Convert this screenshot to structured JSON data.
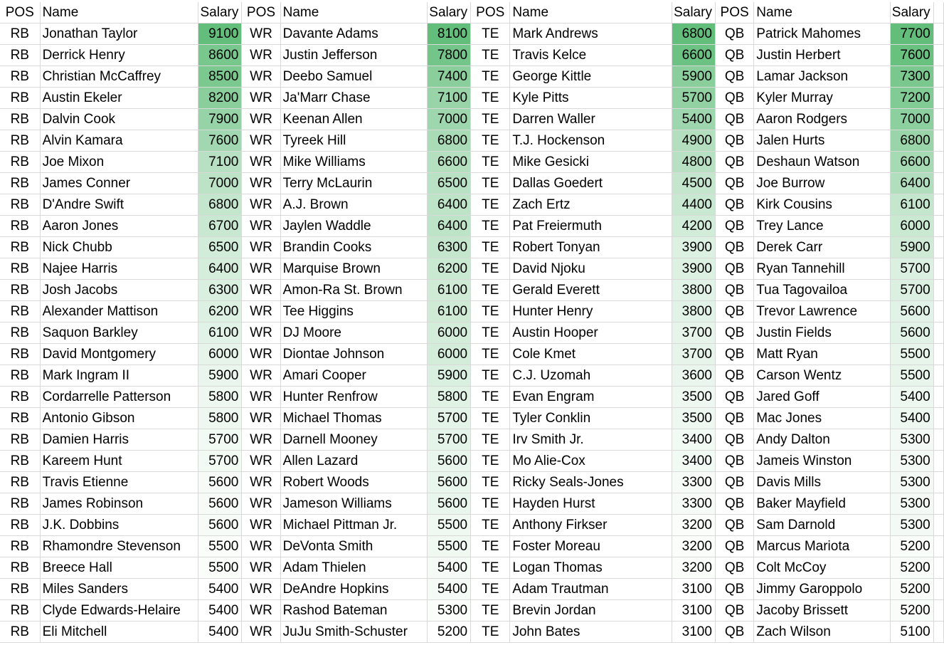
{
  "headers": [
    "POS",
    "Name",
    "Salary"
  ],
  "scale_colors": {
    "min": "#ffffff",
    "max": "#63be7b"
  },
  "groups": [
    {
      "pos": "RB",
      "players": [
        [
          "Jonathan Taylor",
          9100
        ],
        [
          "Derrick Henry",
          8600
        ],
        [
          "Christian McCaffrey",
          8500
        ],
        [
          "Austin Ekeler",
          8200
        ],
        [
          "Dalvin Cook",
          7900
        ],
        [
          "Alvin Kamara",
          7600
        ],
        [
          "Joe Mixon",
          7100
        ],
        [
          "James Conner",
          7000
        ],
        [
          "D'Andre Swift",
          6800
        ],
        [
          "Aaron Jones",
          6700
        ],
        [
          "Nick Chubb",
          6500
        ],
        [
          "Najee Harris",
          6400
        ],
        [
          "Josh Jacobs",
          6300
        ],
        [
          "Alexander Mattison",
          6200
        ],
        [
          "Saquon Barkley",
          6100
        ],
        [
          "David Montgomery",
          6000
        ],
        [
          "Mark Ingram II",
          5900
        ],
        [
          "Cordarrelle Patterson",
          5800
        ],
        [
          "Antonio Gibson",
          5800
        ],
        [
          "Damien Harris",
          5700
        ],
        [
          "Kareem Hunt",
          5700
        ],
        [
          "Travis Etienne",
          5600
        ],
        [
          "James Robinson",
          5600
        ],
        [
          "J.K. Dobbins",
          5600
        ],
        [
          "Rhamondre Stevenson",
          5500
        ],
        [
          "Breece Hall",
          5500
        ],
        [
          "Miles Sanders",
          5400
        ],
        [
          "Clyde Edwards-Helaire",
          5400
        ],
        [
          "Eli Mitchell",
          5400
        ]
      ]
    },
    {
      "pos": "WR",
      "players": [
        [
          "Davante Adams",
          8100
        ],
        [
          "Justin Jefferson",
          7800
        ],
        [
          "Deebo Samuel",
          7400
        ],
        [
          "Ja'Marr Chase",
          7100
        ],
        [
          "Keenan Allen",
          7000
        ],
        [
          "Tyreek Hill",
          6800
        ],
        [
          "Mike Williams",
          6600
        ],
        [
          "Terry McLaurin",
          6500
        ],
        [
          "A.J. Brown",
          6400
        ],
        [
          "Jaylen Waddle",
          6400
        ],
        [
          "Brandin Cooks",
          6300
        ],
        [
          "Marquise Brown",
          6200
        ],
        [
          "Amon-Ra St. Brown",
          6100
        ],
        [
          "Tee Higgins",
          6100
        ],
        [
          "DJ Moore",
          6000
        ],
        [
          "Diontae Johnson",
          6000
        ],
        [
          "Amari Cooper",
          5900
        ],
        [
          "Hunter Renfrow",
          5800
        ],
        [
          "Michael Thomas",
          5700
        ],
        [
          "Darnell Mooney",
          5700
        ],
        [
          "Allen Lazard",
          5600
        ],
        [
          "Robert Woods",
          5600
        ],
        [
          "Jameson Williams",
          5600
        ],
        [
          "Michael Pittman Jr.",
          5500
        ],
        [
          "DeVonta Smith",
          5500
        ],
        [
          "Adam Thielen",
          5400
        ],
        [
          "DeAndre Hopkins",
          5400
        ],
        [
          "Rashod Bateman",
          5300
        ],
        [
          "JuJu Smith-Schuster",
          5200
        ]
      ]
    },
    {
      "pos": "TE",
      "players": [
        [
          "Mark Andrews",
          6800
        ],
        [
          "Travis Kelce",
          6600
        ],
        [
          "George Kittle",
          5900
        ],
        [
          "Kyle Pitts",
          5700
        ],
        [
          "Darren Waller",
          5400
        ],
        [
          "T.J. Hockenson",
          4900
        ],
        [
          "Mike Gesicki",
          4800
        ],
        [
          "Dallas Goedert",
          4500
        ],
        [
          "Zach Ertz",
          4400
        ],
        [
          "Pat Freiermuth",
          4200
        ],
        [
          "Robert Tonyan",
          3900
        ],
        [
          "David Njoku",
          3900
        ],
        [
          "Gerald Everett",
          3800
        ],
        [
          "Hunter Henry",
          3800
        ],
        [
          "Austin Hooper",
          3700
        ],
        [
          "Cole Kmet",
          3700
        ],
        [
          "C.J. Uzomah",
          3600
        ],
        [
          "Evan Engram",
          3500
        ],
        [
          "Tyler Conklin",
          3500
        ],
        [
          "Irv Smith Jr.",
          3400
        ],
        [
          "Mo Alie-Cox",
          3400
        ],
        [
          "Ricky Seals-Jones",
          3300
        ],
        [
          "Hayden Hurst",
          3300
        ],
        [
          "Anthony Firkser",
          3200
        ],
        [
          "Foster Moreau",
          3200
        ],
        [
          "Logan Thomas",
          3200
        ],
        [
          "Adam Trautman",
          3100
        ],
        [
          "Brevin Jordan",
          3100
        ],
        [
          "John Bates",
          3100
        ]
      ]
    },
    {
      "pos": "QB",
      "players": [
        [
          "Patrick Mahomes",
          7700
        ],
        [
          "Justin Herbert",
          7600
        ],
        [
          "Lamar Jackson",
          7300
        ],
        [
          "Kyler Murray",
          7200
        ],
        [
          "Aaron Rodgers",
          7000
        ],
        [
          "Jalen Hurts",
          6800
        ],
        [
          "Deshaun Watson",
          6600
        ],
        [
          "Joe Burrow",
          6400
        ],
        [
          "Kirk Cousins",
          6100
        ],
        [
          "Trey Lance",
          6000
        ],
        [
          "Derek Carr",
          5900
        ],
        [
          "Ryan Tannehill",
          5700
        ],
        [
          "Tua Tagovailoa",
          5700
        ],
        [
          "Trevor Lawrence",
          5600
        ],
        [
          "Justin Fields",
          5600
        ],
        [
          "Matt Ryan",
          5500
        ],
        [
          "Carson Wentz",
          5500
        ],
        [
          "Jared Goff",
          5400
        ],
        [
          "Mac Jones",
          5400
        ],
        [
          "Andy Dalton",
          5300
        ],
        [
          "Jameis Winston",
          5300
        ],
        [
          "Davis Mills",
          5300
        ],
        [
          "Baker Mayfield",
          5300
        ],
        [
          "Sam Darnold",
          5300
        ],
        [
          "Marcus Mariota",
          5200
        ],
        [
          "Colt McCoy",
          5200
        ],
        [
          "Jimmy Garoppolo",
          5200
        ],
        [
          "Jacoby Brissett",
          5200
        ],
        [
          "Zach Wilson",
          5100
        ]
      ]
    }
  ]
}
